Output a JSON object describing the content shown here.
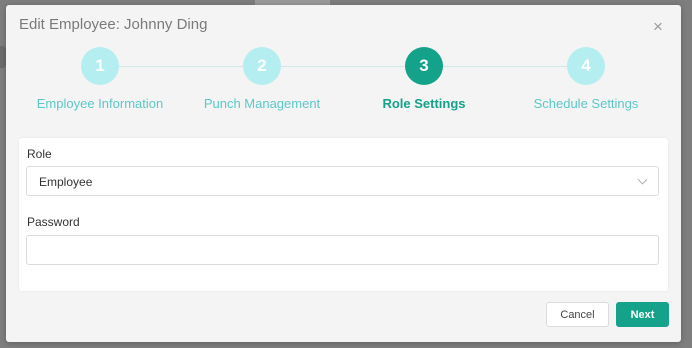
{
  "dialog": {
    "title": "Edit Employee: Johnny Ding",
    "close_symbol": "×"
  },
  "steps": [
    {
      "number": "1",
      "label": "Employee Information",
      "state": "inactive"
    },
    {
      "number": "2",
      "label": "Punch Management",
      "state": "inactive"
    },
    {
      "number": "3",
      "label": "Role Settings",
      "state": "active"
    },
    {
      "number": "4",
      "label": "Schedule Settings",
      "state": "inactive"
    }
  ],
  "form": {
    "role_label": "Role",
    "role_value": "Employee",
    "password_label": "Password",
    "password_value": ""
  },
  "footer": {
    "cancel_label": "Cancel",
    "next_label": "Next"
  },
  "colors": {
    "active_step": "#14a28a",
    "inactive_step": "#b5eef0",
    "inactive_label": "#5cc8c8",
    "primary_button": "#14a28a"
  }
}
